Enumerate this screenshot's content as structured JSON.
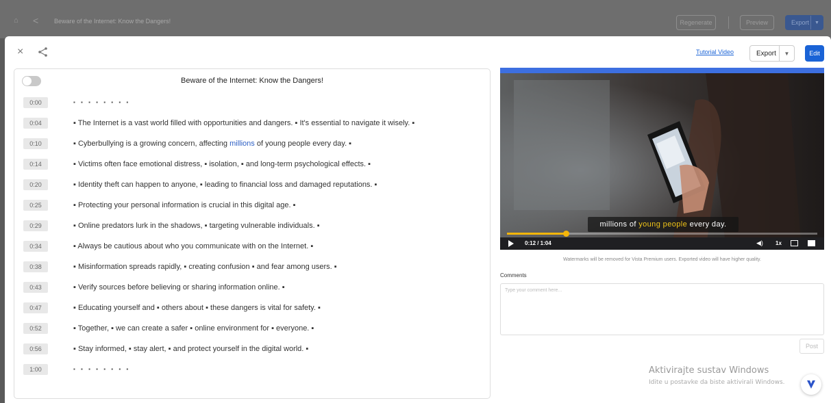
{
  "background_app": {
    "title": "Beware of the Internet: Know the Dangers!",
    "regenerate_label": "Regenerate",
    "preview_label": "Preview",
    "export_label": "Export"
  },
  "modal": {
    "close_glyph": "×",
    "tutorial_label": "Tutorial Video",
    "export_label": "Export",
    "edit_label": "Edit"
  },
  "transcript": {
    "title": "Beware of the Internet: Know the Dangers!",
    "rows": [
      {
        "time": "0:00",
        "text": "▪ ▪ ▪ ▪ ▪ ▪ ▪ ▪"
      },
      {
        "time": "0:04",
        "text": "▪ The Internet is a vast world filled with opportunities and dangers. ▪ It's essential to navigate it wisely. ▪"
      },
      {
        "time": "0:10",
        "pre": "▪ Cyberbullying is a growing concern, affecting ",
        "highlight": "millions",
        "post": " of young people every day. ▪"
      },
      {
        "time": "0:14",
        "text": "▪ Victims often face emotional distress, ▪ isolation, ▪ and long-term psychological effects. ▪"
      },
      {
        "time": "0:20",
        "text": "▪ Identity theft can happen to anyone, ▪ leading to financial loss and damaged reputations. ▪"
      },
      {
        "time": "0:25",
        "text": "▪ Protecting your personal information is crucial in this digital age. ▪"
      },
      {
        "time": "0:29",
        "text": "▪ Online predators lurk in the shadows, ▪ targeting vulnerable individuals. ▪"
      },
      {
        "time": "0:34",
        "text": "▪ Always be cautious about who you communicate with on the Internet. ▪"
      },
      {
        "time": "0:38",
        "text": "▪ Misinformation spreads rapidly, ▪ creating confusion ▪ and fear among users. ▪"
      },
      {
        "time": "0:43",
        "text": "▪ Verify sources before believing or sharing information online. ▪"
      },
      {
        "time": "0:47",
        "text": "▪ Educating yourself and ▪ others about ▪ these dangers is vital for safety. ▪"
      },
      {
        "time": "0:52",
        "text": "▪ Together, ▪ we can create a safer ▪ online environment for ▪ everyone. ▪"
      },
      {
        "time": "0:56",
        "text": "▪ Stay informed, ▪ stay alert, ▪ and protect yourself in the digital world. ▪"
      },
      {
        "time": "1:00",
        "text": "▪ ▪ ▪ ▪ ▪ ▪ ▪ ▪"
      }
    ]
  },
  "video": {
    "subtitle_pre": "millions of ",
    "subtitle_hl": "young people",
    "subtitle_post": " every day.",
    "time_display": "0:12 / 1:04",
    "speed": "1x",
    "progress": 0.19
  },
  "watermark_note": "Watermarks will be removed for Vista Premium users. Exported video will have higher quality.",
  "comments": {
    "label": "Comments",
    "placeholder": "Type your comment here...",
    "post_label": "Post"
  },
  "windows_activation": {
    "title": "Aktivirajte sustav Windows",
    "subtitle": "Idite u postavke da biste aktivirali Windows."
  },
  "colors": {
    "accent": "#1a63d6",
    "subtitle_highlight": "#f0c419",
    "progress": "#f5b60a"
  }
}
